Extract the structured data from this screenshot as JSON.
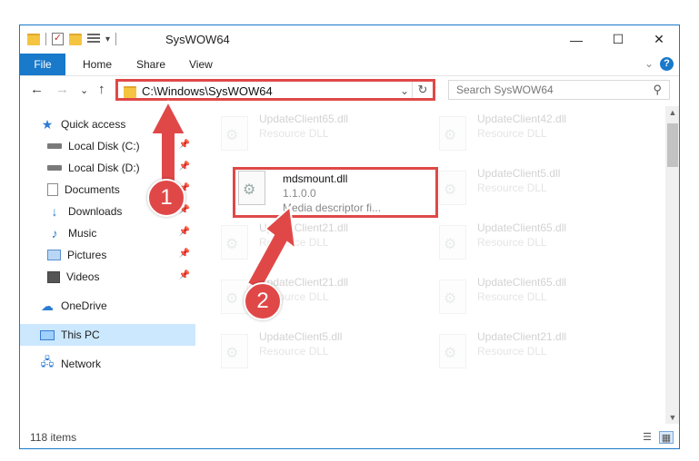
{
  "window": {
    "title": "SysWOW64",
    "minimize_glyph": "—",
    "maximize_glyph": "☐",
    "close_glyph": "✕"
  },
  "ribbon": {
    "tabs": [
      "File",
      "Home",
      "Share",
      "View"
    ],
    "help_glyph": "?",
    "collapse_glyph": "⌄"
  },
  "navigation": {
    "back_glyph": "←",
    "forward_glyph": "→",
    "recent_glyph": "⌄",
    "up_glyph": "↑"
  },
  "address": {
    "path": "C:\\Windows\\SysWOW64",
    "dropdown_glyph": "⌄",
    "refresh_glyph": "↻"
  },
  "search": {
    "placeholder": "Search SysWOW64",
    "icon_glyph": "⚲"
  },
  "sidebar": {
    "items": [
      {
        "label": "Quick access",
        "icon": "star-icon",
        "pinned": false
      },
      {
        "label": "Local Disk (C:)",
        "icon": "drive-icon",
        "pinned": true
      },
      {
        "label": "Local Disk (D:)",
        "icon": "drive-icon",
        "pinned": true
      },
      {
        "label": "Documents",
        "icon": "documents-icon",
        "pinned": true
      },
      {
        "label": "Downloads",
        "icon": "downloads-icon",
        "pinned": true
      },
      {
        "label": "Music",
        "icon": "music-icon",
        "pinned": true
      },
      {
        "label": "Pictures",
        "icon": "pictures-icon",
        "pinned": true
      },
      {
        "label": "Videos",
        "icon": "videos-icon",
        "pinned": true
      },
      {
        "label": "OneDrive",
        "icon": "onedrive-icon",
        "pinned": false
      },
      {
        "label": "This PC",
        "icon": "this-pc-icon",
        "pinned": false,
        "selected": true
      },
      {
        "label": "Network",
        "icon": "network-icon",
        "pinned": false
      }
    ],
    "pin_glyph": "📌"
  },
  "files": [
    {
      "name": "UpdateClient65.dll",
      "type": "Resource DLL"
    },
    {
      "name": "UpdateClient42.dll",
      "type": "Resource DLL"
    },
    {
      "name": "mdsmount.dll",
      "version": "1.1.0.0",
      "description": "Media descriptor fi..."
    },
    {
      "name": "UpdateClient5.dll",
      "type": "Resource DLL"
    },
    {
      "name": "UpdateClient21.dll",
      "type": "Resource DLL"
    },
    {
      "name": "UpdateClient65.dll",
      "type": "Resource DLL"
    },
    {
      "name": "UpdateClient21.dll",
      "type": "Resource DLL"
    },
    {
      "name": "UpdateClient65.dll",
      "type": "Resource DLL"
    },
    {
      "name": "UpdateClient5.dll",
      "type": "Resource DLL"
    },
    {
      "name": "UpdateClient21.dll",
      "type": "Resource DLL"
    }
  ],
  "annotations": {
    "badge1": "1",
    "badge2": "2",
    "color": "#e04848"
  },
  "status": {
    "item_count": "118 items"
  },
  "colors": {
    "accent": "#1979ca",
    "selection": "#cce8ff",
    "callout": "#e04848"
  }
}
